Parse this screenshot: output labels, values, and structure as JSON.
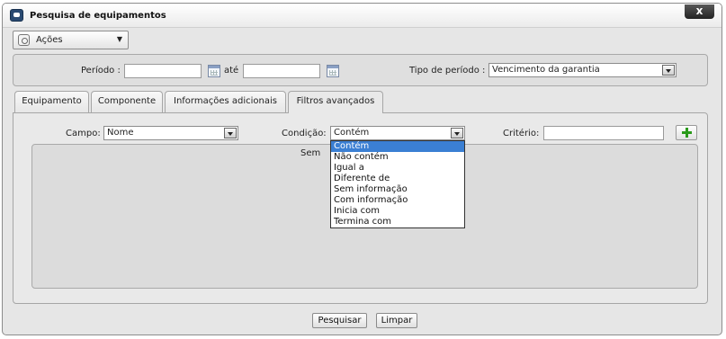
{
  "window": {
    "title": "Pesquisa de equipamentos",
    "close_label": "x"
  },
  "actions": {
    "label": "Ações"
  },
  "period": {
    "label": "Período :",
    "from_value": "",
    "until_label": "até",
    "to_value": "",
    "type_label": "Tipo de período :",
    "type_value": "Vencimento da garantia"
  },
  "tabs": [
    {
      "label": "Equipamento"
    },
    {
      "label": "Componente"
    },
    {
      "label": "Informações adicionais"
    },
    {
      "label": "Filtros avançados"
    }
  ],
  "filters": {
    "field_label": "Campo:",
    "field_value": "Nome",
    "condition_label": "Condição:",
    "condition_value": "Contém",
    "criteria_label": "Critério:",
    "criteria_value": "",
    "empty_text": "Sem",
    "condition_options": [
      "Contém",
      "Não contém",
      "Igual a",
      "Diferente de",
      "Sem informação",
      "Com informação",
      "Inicia com",
      "Termina com"
    ]
  },
  "buttons": {
    "search": "Pesquisar",
    "clear": "Limpar"
  },
  "colors": {
    "selected_option": "#3b7fd3",
    "add_icon": "#2a9a1a"
  }
}
